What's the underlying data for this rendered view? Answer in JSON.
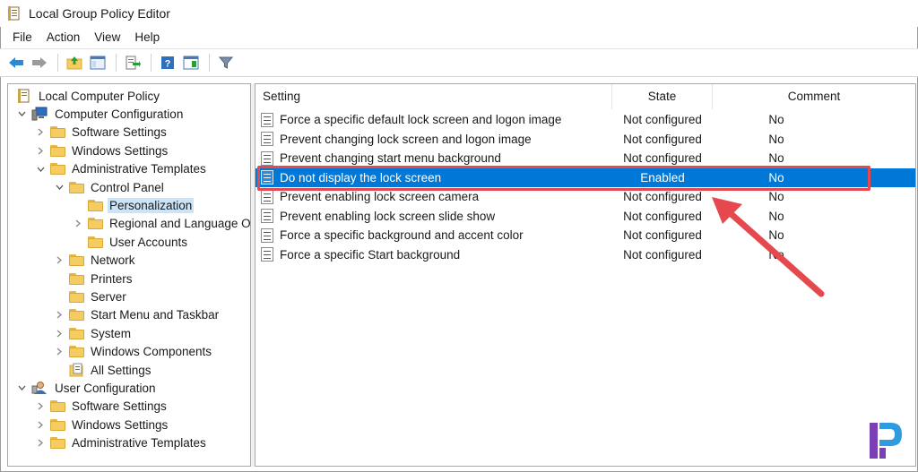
{
  "window": {
    "title": "Local Group Policy Editor"
  },
  "menu": [
    "File",
    "Action",
    "View",
    "Help"
  ],
  "toolbar": {
    "icons": [
      "back-arrow-icon",
      "forward-arrow-icon",
      "up-folder-icon",
      "show-hide-tree-icon",
      "export-list-icon",
      "help-icon",
      "extended-view-icon",
      "filter-icon"
    ]
  },
  "tree": [
    {
      "label": "Local Computer Policy",
      "level": 0,
      "chevron": "",
      "icon": "computer-policy-icon"
    },
    {
      "label": "Computer Configuration",
      "level": 1,
      "chevron": "down",
      "icon": "computer-icon"
    },
    {
      "label": "Software Settings",
      "level": 2,
      "chevron": "right",
      "icon": "folder-icon"
    },
    {
      "label": "Windows Settings",
      "level": 2,
      "chevron": "right",
      "icon": "folder-icon"
    },
    {
      "label": "Administrative Templates",
      "level": 2,
      "chevron": "down",
      "icon": "folder-icon"
    },
    {
      "label": "Control Panel",
      "level": 3,
      "chevron": "down",
      "icon": "folder-icon"
    },
    {
      "label": "Personalization",
      "level": 4,
      "chevron": "",
      "icon": "folder-icon",
      "selected": true
    },
    {
      "label": "Regional and Language O",
      "level": 4,
      "chevron": "right",
      "icon": "folder-icon"
    },
    {
      "label": "User Accounts",
      "level": 4,
      "chevron": "",
      "icon": "folder-icon"
    },
    {
      "label": "Network",
      "level": 3,
      "chevron": "right",
      "icon": "folder-icon"
    },
    {
      "label": "Printers",
      "level": 3,
      "chevron": "",
      "icon": "folder-icon"
    },
    {
      "label": "Server",
      "level": 3,
      "chevron": "",
      "icon": "folder-icon"
    },
    {
      "label": "Start Menu and Taskbar",
      "level": 3,
      "chevron": "right",
      "icon": "folder-icon"
    },
    {
      "label": "System",
      "level": 3,
      "chevron": "right",
      "icon": "folder-icon"
    },
    {
      "label": "Windows Components",
      "level": 3,
      "chevron": "right",
      "icon": "folder-icon"
    },
    {
      "label": "All Settings",
      "level": 3,
      "chevron": "",
      "icon": "all-settings-icon"
    },
    {
      "label": "User Configuration",
      "level": 1,
      "chevron": "down",
      "icon": "user-icon"
    },
    {
      "label": "Software Settings",
      "level": 2,
      "chevron": "right",
      "icon": "folder-icon"
    },
    {
      "label": "Windows Settings",
      "level": 2,
      "chevron": "right",
      "icon": "folder-icon"
    },
    {
      "label": "Administrative Templates",
      "level": 2,
      "chevron": "right",
      "icon": "folder-icon"
    }
  ],
  "list": {
    "columns": {
      "setting": "Setting",
      "state": "State",
      "comment": "Comment"
    },
    "rows": [
      {
        "setting": "Force a specific default lock screen and logon image",
        "state": "Not configured",
        "comment": "No"
      },
      {
        "setting": "Prevent changing lock screen and logon image",
        "state": "Not configured",
        "comment": "No"
      },
      {
        "setting": "Prevent changing start menu background",
        "state": "Not configured",
        "comment": "No"
      },
      {
        "setting": "Do not display the lock screen",
        "state": "Enabled",
        "comment": "No",
        "selected": true
      },
      {
        "setting": "Prevent enabling lock screen camera",
        "state": "Not configured",
        "comment": "No"
      },
      {
        "setting": "Prevent enabling lock screen slide show",
        "state": "Not configured",
        "comment": "No"
      },
      {
        "setting": "Force a specific background and accent color",
        "state": "Not configured",
        "comment": "No"
      },
      {
        "setting": "Force a specific Start background",
        "state": "Not configured",
        "comment": "No"
      }
    ]
  },
  "colors": {
    "selection": "#0078d7",
    "tree_selection": "#cce4f7",
    "annotation": "#e5484d",
    "logo": "#7b3fb6"
  }
}
